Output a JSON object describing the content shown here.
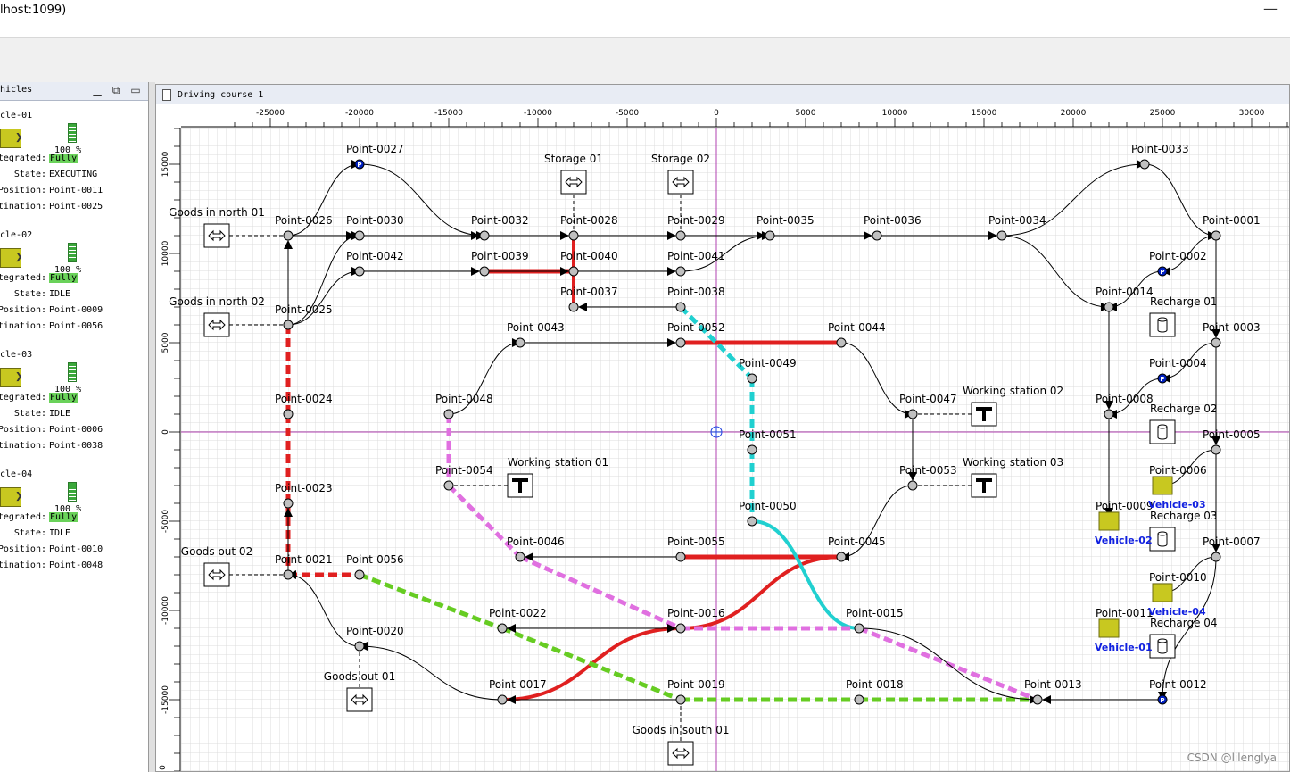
{
  "window": {
    "title": "lhost:1099)",
    "minimize_symbol": "—"
  },
  "vehicle_panel": {
    "title": "hicles",
    "vehicles": [
      {
        "name": "cle-01",
        "battery": "100 %",
        "battery_level": 1.0,
        "integrated_label": "tegrated:",
        "integrated": "Fully",
        "state_label": "State:",
        "state": "EXECUTING",
        "position_label": "Position:",
        "position": "Point-0011",
        "destination_label": "tination:",
        "destination": "Point-0025"
      },
      {
        "name": "cle-02",
        "battery": "100 %",
        "battery_level": 1.0,
        "integrated_label": "tegrated:",
        "integrated": "Fully",
        "state_label": "State:",
        "state": "IDLE",
        "position_label": "Position:",
        "position": "Point-0009",
        "destination_label": "tination:",
        "destination": "Point-0056"
      },
      {
        "name": "cle-03",
        "battery": "100 %",
        "battery_level": 1.0,
        "integrated_label": "tegrated:",
        "integrated": "Fully",
        "state_label": "State:",
        "state": "IDLE",
        "position_label": "Position:",
        "position": "Point-0006",
        "destination_label": "tination:",
        "destination": "Point-0038"
      },
      {
        "name": "cle-04",
        "battery": "100 %",
        "battery_level": 1.0,
        "integrated_label": "tegrated:",
        "integrated": "Fully",
        "state_label": "State:",
        "state": "IDLE",
        "position_label": "Position:",
        "position": "Point-0010",
        "destination_label": "tination:",
        "destination": "Point-0048"
      }
    ]
  },
  "course": {
    "title": "Driving course 1",
    "x_ticks": [
      -25000,
      -20000,
      -15000,
      -10000,
      -5000,
      0,
      5000,
      10000,
      15000,
      20000,
      25000,
      30000
    ],
    "y_ticks": [
      15000,
      10000,
      5000,
      0,
      -5000,
      -10000,
      -15000
    ],
    "y_tick_bottom": "0",
    "points": [
      {
        "id": "Point-0027",
        "x": -20000,
        "y": 15000,
        "type": "park"
      },
      {
        "id": "Point-0026",
        "x": -24000,
        "y": 11000
      },
      {
        "id": "Point-0030",
        "x": -20000,
        "y": 11000
      },
      {
        "id": "Point-0032",
        "x": -13000,
        "y": 11000
      },
      {
        "id": "Point-0028",
        "x": -8000,
        "y": 11000
      },
      {
        "id": "Point-0029",
        "x": -2000,
        "y": 11000
      },
      {
        "id": "Point-0035",
        "x": 3000,
        "y": 11000
      },
      {
        "id": "Point-0036",
        "x": 9000,
        "y": 11000
      },
      {
        "id": "Point-0034",
        "x": 16000,
        "y": 11000
      },
      {
        "id": "Point-0001",
        "x": 28000,
        "y": 11000
      },
      {
        "id": "Point-0033",
        "x": 24000,
        "y": 15000
      },
      {
        "id": "Point-0042",
        "x": -20000,
        "y": 9000
      },
      {
        "id": "Point-0039",
        "x": -13000,
        "y": 9000
      },
      {
        "id": "Point-0040",
        "x": -8000,
        "y": 9000
      },
      {
        "id": "Point-0041",
        "x": -2000,
        "y": 9000
      },
      {
        "id": "Point-0002",
        "x": 25000,
        "y": 9000,
        "type": "park"
      },
      {
        "id": "Point-0037",
        "x": -8000,
        "y": 7000
      },
      {
        "id": "Point-0038",
        "x": -2000,
        "y": 7000
      },
      {
        "id": "Point-0014",
        "x": 22000,
        "y": 7000
      },
      {
        "id": "Point-0025",
        "x": -24000,
        "y": 6000
      },
      {
        "id": "Point-0043",
        "x": -11000,
        "y": 5000
      },
      {
        "id": "Point-0052",
        "x": -2000,
        "y": 5000
      },
      {
        "id": "Point-0044",
        "x": 7000,
        "y": 5000
      },
      {
        "id": "Point-0003",
        "x": 28000,
        "y": 5000
      },
      {
        "id": "Point-0049",
        "x": 2000,
        "y": 3000
      },
      {
        "id": "Point-0004",
        "x": 25000,
        "y": 3000,
        "type": "park"
      },
      {
        "id": "Point-0048",
        "x": -15000,
        "y": 1000
      },
      {
        "id": "Point-0024",
        "x": -24000,
        "y": 1000
      },
      {
        "id": "Point-0047",
        "x": 11000,
        "y": 1000
      },
      {
        "id": "Point-0008",
        "x": 22000,
        "y": 1000
      },
      {
        "id": "Point-0051",
        "x": 2000,
        "y": -1000
      },
      {
        "id": "Point-0005",
        "x": 28000,
        "y": -1000
      },
      {
        "id": "Point-0054",
        "x": -15000,
        "y": -3000
      },
      {
        "id": "Point-0053",
        "x": 11000,
        "y": -3000
      },
      {
        "id": "Point-0006",
        "x": 25000,
        "y": -3000
      },
      {
        "id": "Point-0023",
        "x": -24000,
        "y": -4000
      },
      {
        "id": "Point-0050",
        "x": 2000,
        "y": -5000
      },
      {
        "id": "Point-0009",
        "x": 22000,
        "y": -5000
      },
      {
        "id": "Point-0046",
        "x": -11000,
        "y": -7000
      },
      {
        "id": "Point-0055",
        "x": -2000,
        "y": -7000
      },
      {
        "id": "Point-0045",
        "x": 7000,
        "y": -7000
      },
      {
        "id": "Point-0007",
        "x": 28000,
        "y": -7000
      },
      {
        "id": "Point-0021",
        "x": -24000,
        "y": -8000
      },
      {
        "id": "Point-0056",
        "x": -20000,
        "y": -8000
      },
      {
        "id": "Point-0010",
        "x": 25000,
        "y": -9000
      },
      {
        "id": "Point-0022",
        "x": -12000,
        "y": -11000
      },
      {
        "id": "Point-0016",
        "x": -2000,
        "y": -11000
      },
      {
        "id": "Point-0015",
        "x": 8000,
        "y": -11000
      },
      {
        "id": "Point-0011",
        "x": 22000,
        "y": -11000
      },
      {
        "id": "Point-0020",
        "x": -20000,
        "y": -12000
      },
      {
        "id": "Point-0017",
        "x": -12000,
        "y": -15000
      },
      {
        "id": "Point-0019",
        "x": -2000,
        "y": -15000
      },
      {
        "id": "Point-0018",
        "x": 8000,
        "y": -15000
      },
      {
        "id": "Point-0013",
        "x": 18000,
        "y": -15000
      },
      {
        "id": "Point-0012",
        "x": 25000,
        "y": -15000,
        "type": "park"
      }
    ],
    "locations": [
      {
        "name": "Goods in north 01",
        "x": -28000,
        "y": 11000,
        "type": "transfer",
        "label_pos": "above"
      },
      {
        "name": "Goods in north 02",
        "x": -28000,
        "y": 6000,
        "type": "transfer",
        "label_pos": "above"
      },
      {
        "name": "Goods out 02",
        "x": -28000,
        "y": -8000,
        "type": "transfer",
        "label_pos": "above"
      },
      {
        "name": "Goods out 01",
        "x": -20000,
        "y": -15000,
        "type": "transfer",
        "label_pos": "above"
      },
      {
        "name": "Storage 01",
        "x": -8000,
        "y": 14000,
        "type": "transfer",
        "label_pos": "above"
      },
      {
        "name": "Storage 02",
        "x": -2000,
        "y": 14000,
        "type": "transfer",
        "label_pos": "above"
      },
      {
        "name": "Goods in south 01",
        "x": -2000,
        "y": -18000,
        "type": "transfer",
        "label_pos": "above"
      },
      {
        "name": "Working station 01",
        "x": -11000,
        "y": -3000,
        "type": "work",
        "label_pos": "right-above"
      },
      {
        "name": "Working station 02",
        "x": 15000,
        "y": 1000,
        "type": "work",
        "label_pos": "above-left"
      },
      {
        "name": "Working station 03",
        "x": 15000,
        "y": -3000,
        "type": "work",
        "label_pos": "above-left"
      },
      {
        "name": "Recharge 01",
        "x": 25000,
        "y": 6000,
        "type": "recharge",
        "label_pos": "above"
      },
      {
        "name": "Recharge 02",
        "x": 25000,
        "y": 0,
        "type": "recharge",
        "label_pos": "above"
      },
      {
        "name": "Recharge 03",
        "x": 25000,
        "y": -6000,
        "type": "recharge",
        "label_pos": "above"
      },
      {
        "name": "Recharge 04",
        "x": 25000,
        "y": -12000,
        "type": "recharge",
        "label_pos": "above"
      }
    ],
    "location_links": [
      [
        "Goods in north 01",
        "Point-0026"
      ],
      [
        "Goods in north 02",
        "Point-0025"
      ],
      [
        "Goods out 02",
        "Point-0021"
      ],
      [
        "Goods out 01",
        "Point-0020"
      ],
      [
        "Storage 01",
        "Point-0028"
      ],
      [
        "Storage 02",
        "Point-0029"
      ],
      [
        "Goods in south 01",
        "Point-0019"
      ],
      [
        "Working station 01",
        "Point-0054"
      ],
      [
        "Working station 02",
        "Point-0047"
      ],
      [
        "Working station 03",
        "Point-0053"
      ]
    ],
    "paths": [
      [
        "Point-0025",
        "Point-0026",
        "s"
      ],
      [
        "Point-0026",
        "Point-0027",
        "c"
      ],
      [
        "Point-0027",
        "Point-0032",
        "c"
      ],
      [
        "Point-0025",
        "Point-0030",
        "c"
      ],
      [
        "Point-0026",
        "Point-0030",
        "s"
      ],
      [
        "Point-0030",
        "Point-0032",
        "s"
      ],
      [
        "Point-0032",
        "Point-0028",
        "s"
      ],
      [
        "Point-0028",
        "Point-0029",
        "s"
      ],
      [
        "Point-0029",
        "Point-0035",
        "s"
      ],
      [
        "Point-0035",
        "Point-0036",
        "s"
      ],
      [
        "Point-0036",
        "Point-0034",
        "s"
      ],
      [
        "Point-0034",
        "Point-0033",
        "c"
      ],
      [
        "Point-0033",
        "Point-0001",
        "c"
      ],
      [
        "Point-0034",
        "Point-0014",
        "c"
      ],
      [
        "Point-0001",
        "Point-0002",
        "c"
      ],
      [
        "Point-0001",
        "Point-0003",
        "s"
      ],
      [
        "Point-0002",
        "Point-0014",
        "c"
      ],
      [
        "Point-0014",
        "Point-0008",
        "s"
      ],
      [
        "Point-0003",
        "Point-0004",
        "c"
      ],
      [
        "Point-0004",
        "Point-0008",
        "c"
      ],
      [
        "Point-0003",
        "Point-0005",
        "s"
      ],
      [
        "Point-0005",
        "Point-0006",
        "c"
      ],
      [
        "Point-0005",
        "Point-0007",
        "s"
      ],
      [
        "Point-0008",
        "Point-0009",
        "s"
      ],
      [
        "Point-0007",
        "Point-0010",
        "c"
      ],
      [
        "Point-0007",
        "Point-0012",
        "c"
      ],
      [
        "Point-0012",
        "Point-0013",
        "s"
      ],
      [
        "Point-0025",
        "Point-0042",
        "c"
      ],
      [
        "Point-0042",
        "Point-0039",
        "s"
      ],
      [
        "Point-0039",
        "Point-0040",
        "s"
      ],
      [
        "Point-0040",
        "Point-0041",
        "s"
      ],
      [
        "Point-0041",
        "Point-0035",
        "c"
      ],
      [
        "Point-0038",
        "Point-0037",
        "s"
      ],
      [
        "Point-0043",
        "Point-0052",
        "s"
      ],
      [
        "Point-0048",
        "Point-0043",
        "c"
      ],
      [
        "Point-0044",
        "Point-0047",
        "c"
      ],
      [
        "Point-0047",
        "Point-0053",
        "s"
      ],
      [
        "Point-0053",
        "Point-0045",
        "c"
      ],
      [
        "Point-0055",
        "Point-0046",
        "s"
      ],
      [
        "Point-0022",
        "Point-0016",
        "s"
      ],
      [
        "Point-0016",
        "Point-0022",
        "s"
      ],
      [
        "Point-0017",
        "Point-0020",
        "c"
      ],
      [
        "Point-0020",
        "Point-0021",
        "c"
      ],
      [
        "Point-0019",
        "Point-0017",
        "s"
      ],
      [
        "Point-0021",
        "Point-0023",
        "s"
      ],
      [
        "Point-0015",
        "Point-0013",
        "c"
      ]
    ],
    "routes": [
      {
        "color": "#e02020",
        "dash": true,
        "pts": [
          "Point-0025",
          "Point-0024",
          "Point-0023",
          "Point-0021",
          "Point-0056"
        ]
      },
      {
        "color": "#e02020",
        "dash": false,
        "pts": [
          "Point-0039",
          "Point-0040"
        ]
      },
      {
        "color": "#e02020",
        "dash": false,
        "curve": [
          [
            "Point-0028",
            "Point-0037"
          ]
        ]
      },
      {
        "color": "#e02020",
        "dash": false,
        "pts": [
          "Point-0052",
          "Point-0044"
        ]
      },
      {
        "color": "#e02020",
        "dash": false,
        "pts": [
          "Point-0045",
          "Point-0055"
        ]
      },
      {
        "color": "#e02020",
        "dash": false,
        "curve": [
          [
            "Point-0045",
            "Point-0016"
          ],
          [
            "Point-0016",
            "Point-0017"
          ]
        ]
      },
      {
        "color": "#66cc22",
        "dash": true,
        "pts": [
          "Point-0056",
          "Point-0022",
          "Point-0019",
          "Point-0018",
          "Point-0013"
        ]
      },
      {
        "color": "#20d0d0",
        "dash": true,
        "pts": [
          "Point-0038",
          "Point-0049",
          "Point-0051",
          "Point-0050"
        ]
      },
      {
        "color": "#20d0d0",
        "dash": false,
        "curve": [
          [
            "Point-0050",
            "Point-0015"
          ]
        ]
      },
      {
        "color": "#e070e0",
        "dash": true,
        "pts": [
          "Point-0048",
          "Point-0054",
          "Point-0046",
          "Point-0016",
          "Point-0015",
          "Point-0013"
        ]
      }
    ],
    "vehicles": [
      {
        "name": "Vehicle-01",
        "at": "Point-0011"
      },
      {
        "name": "Vehicle-02",
        "at": "Point-0009"
      },
      {
        "name": "Vehicle-03",
        "at": "Point-0006"
      },
      {
        "name": "Vehicle-04",
        "at": "Point-0010"
      }
    ]
  },
  "watermark": "CSDN @lilenglya"
}
